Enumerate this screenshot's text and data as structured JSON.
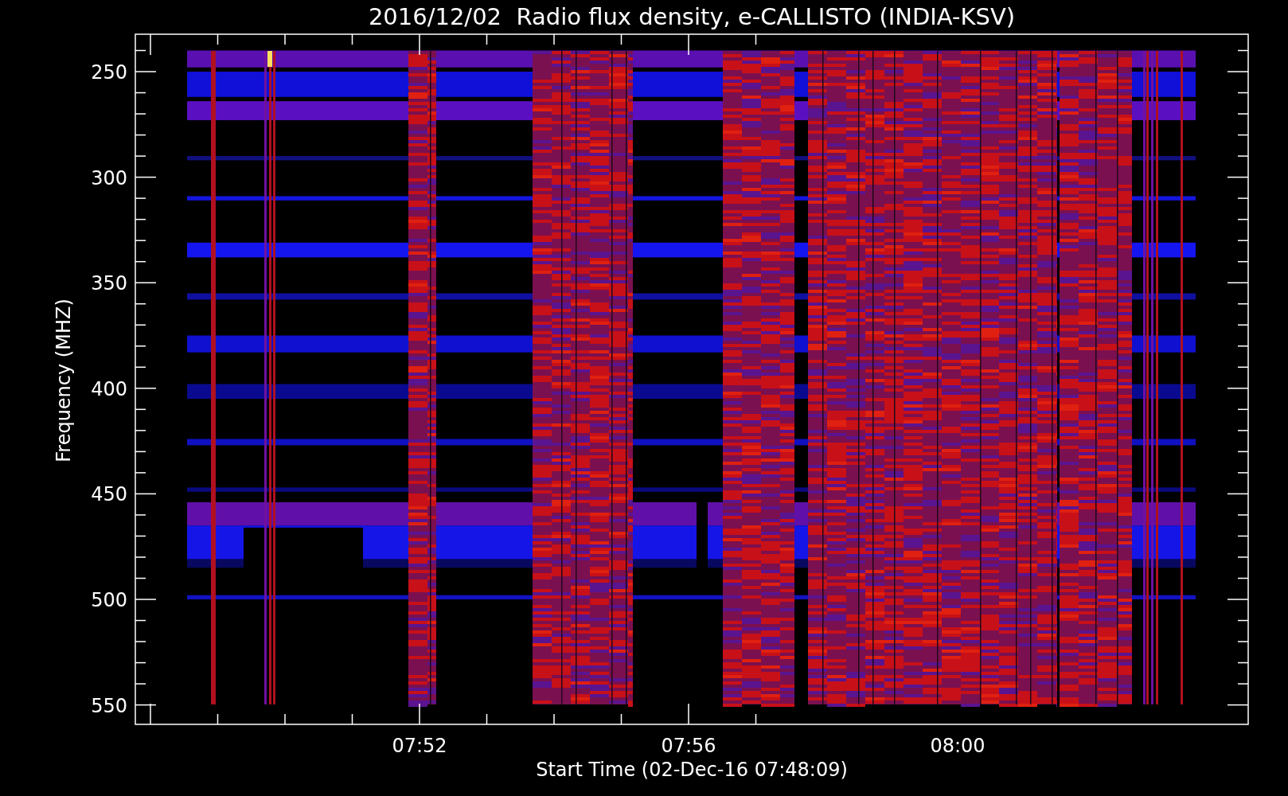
{
  "title": "2016/12/02  Radio flux density, e-CALLISTO (INDIA-KSV)",
  "y_axis": {
    "label": "Frequency (MHZ)",
    "ticks": [
      "250",
      "300",
      "350",
      "400",
      "450",
      "500",
      "550"
    ]
  },
  "x_axis": {
    "label": "Start Time (02-Dec-16 07:48:09)",
    "ticks": [
      "07:52",
      "07:56",
      "08:00"
    ]
  }
}
